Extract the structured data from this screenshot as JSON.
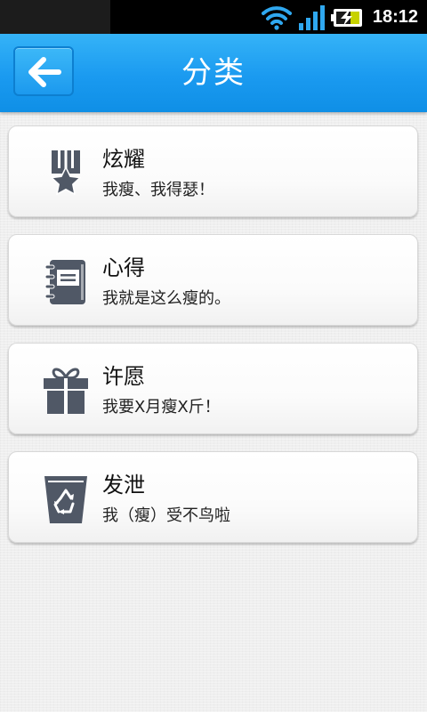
{
  "status_bar": {
    "time": "18:12",
    "icons": [
      "wifi-icon",
      "signal-icon",
      "battery-charging-icon"
    ]
  },
  "header": {
    "title": "分类",
    "back_icon": "arrow-left-icon",
    "color": "#1a9af0"
  },
  "categories": [
    {
      "title": "炫耀",
      "subtitle": "我瘦、我得瑟！",
      "icon": "medal-icon"
    },
    {
      "title": "心得",
      "subtitle": "我就是这么瘦的。",
      "icon": "notebook-icon"
    },
    {
      "title": "许愿",
      "subtitle": "我要X月瘦X斤！",
      "icon": "gift-icon"
    },
    {
      "title": "发泄",
      "subtitle": "我（瘦）受不鸟啦",
      "icon": "recycle-bin-icon"
    }
  ],
  "colors": {
    "icon": "#505866",
    "background": "#efefef"
  }
}
